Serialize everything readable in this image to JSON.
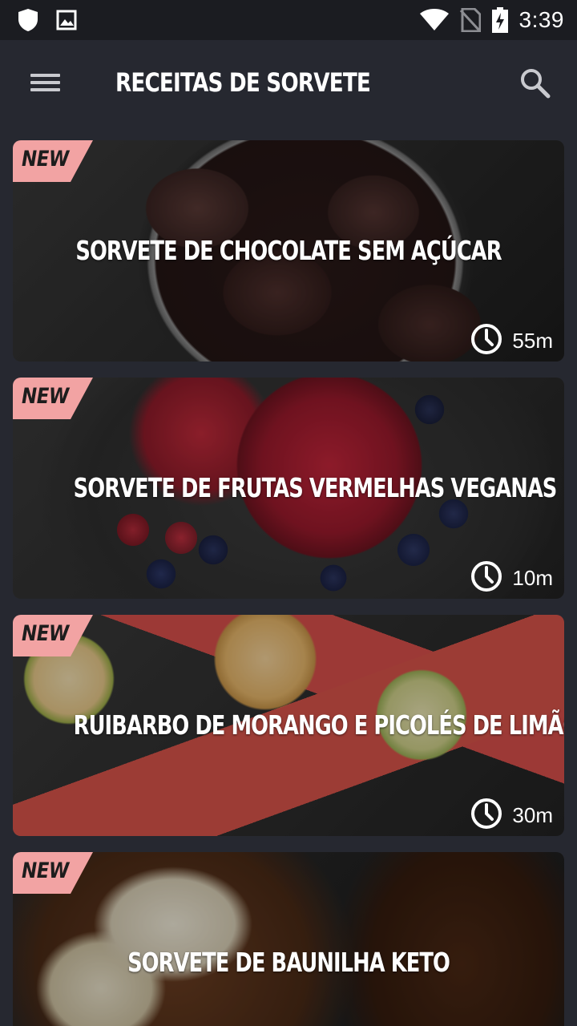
{
  "status_bar": {
    "time": "3:39",
    "icons": [
      "shield-icon",
      "image-icon",
      "wifi-icon",
      "no-sim-icon",
      "battery-charging-icon"
    ]
  },
  "app_bar": {
    "title": "RECEITAS DE SORVETE",
    "menu_icon": "menu-icon",
    "search_icon": "search-icon"
  },
  "colors": {
    "background": "#262830",
    "status_bar": "#1b1c21",
    "badge": "#f2a3a3"
  },
  "recipes": [
    {
      "badge": "NEW",
      "title": "SORVETE DE CHOCOLATE SEM AÇÚCAR",
      "time": "55m"
    },
    {
      "badge": "NEW",
      "title": "SORVETE DE FRUTAS VERMELHAS VEGANAS",
      "time": "10m"
    },
    {
      "badge": "NEW",
      "title": "RUIBARBO DE MORANGO E PICOLÉS DE LIMÃO",
      "time": "30m"
    },
    {
      "badge": "NEW",
      "title": "SORVETE DE BAUNILHA KETO",
      "time": ""
    }
  ]
}
